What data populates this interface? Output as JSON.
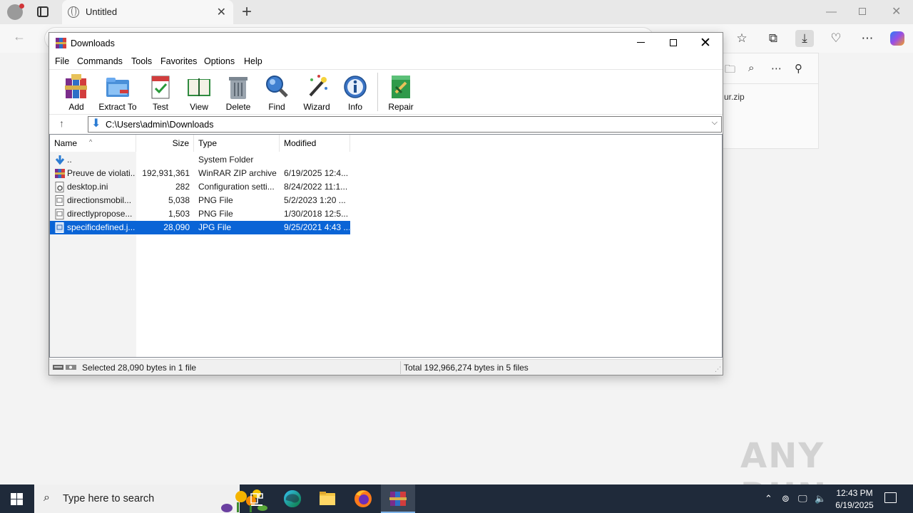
{
  "browser": {
    "tab_title": "Untitled",
    "download_item": "ur.zip"
  },
  "winrar": {
    "title": "Downloads",
    "menu": [
      "File",
      "Commands",
      "Tools",
      "Favorites",
      "Options",
      "Help"
    ],
    "toolbar": [
      "Add",
      "Extract To",
      "Test",
      "View",
      "Delete",
      "Find",
      "Wizard",
      "Info",
      "Repair"
    ],
    "path": "C:\\Users\\admin\\Downloads",
    "columns": {
      "name": "Name",
      "size": "Size",
      "type": "Type",
      "modified": "Modified"
    },
    "files": [
      {
        "name": "..",
        "size": "",
        "type": "System Folder",
        "modified": "",
        "icon": "folder-up-icon"
      },
      {
        "name": "Preuve de violati...",
        "size": "192,931,361",
        "type": "WinRAR ZIP archive",
        "modified": "6/19/2025 12:4...",
        "icon": "zip-archive-icon"
      },
      {
        "name": "desktop.ini",
        "size": "282",
        "type": "Configuration setti...",
        "modified": "8/24/2022 11:1...",
        "icon": "config-file-icon"
      },
      {
        "name": "directionsmobil...",
        "size": "5,038",
        "type": "PNG File",
        "modified": "5/2/2023 1:20 ...",
        "icon": "image-file-icon"
      },
      {
        "name": "directlypropose...",
        "size": "1,503",
        "type": "PNG File",
        "modified": "1/30/2018 12:5...",
        "icon": "image-file-icon"
      },
      {
        "name": "specificdefined.j...",
        "size": "28,090",
        "type": "JPG File",
        "modified": "9/25/2021 4:43 ...",
        "icon": "image-file-icon",
        "selected": true
      }
    ],
    "status_left": "Selected 28,090 bytes in 1 file",
    "status_right": "Total 192,966,274 bytes in 5 files"
  },
  "watermark": "ANY RUN",
  "taskbar": {
    "search_placeholder": "Type here to search",
    "time": "12:43 PM",
    "date": "6/19/2025"
  }
}
